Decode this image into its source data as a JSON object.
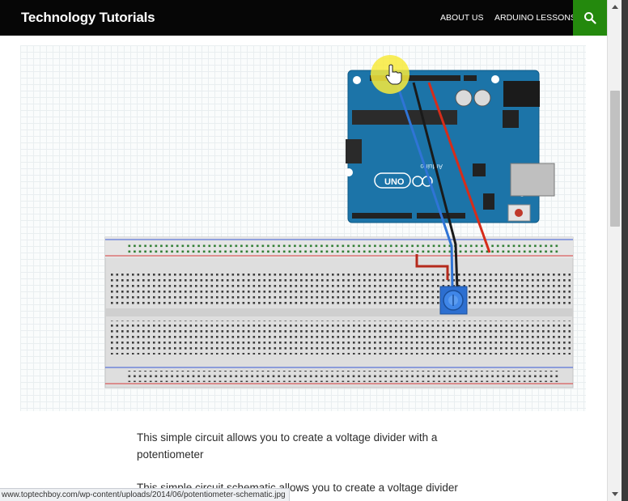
{
  "header": {
    "site_title": "Technology Tutorials",
    "nav": [
      {
        "label": "ABOUT US"
      },
      {
        "label": "ARDUINO LESSONS"
      }
    ],
    "search_icon": "search-icon",
    "accent_color": "#24890d"
  },
  "figure": {
    "board_label": "UNO",
    "board_brand": "Arduino",
    "components": [
      "arduino-uno-board",
      "breadboard",
      "potentiometer",
      "wire-red",
      "wire-black",
      "wire-blue"
    ],
    "wire_colors": {
      "red": "#d62c1a",
      "black": "#1a1a1a",
      "blue": "#2f74d6"
    }
  },
  "content": {
    "paragraph1": "This simple circuit allows you to create a voltage divider with a potentiometer",
    "paragraph2": "This simple circuit schematic allows you to create a voltage divider"
  },
  "status_bar": {
    "url": "www.toptechboy.com/wp-content/uploads/2014/06/potentiometer-schematic.jpg"
  }
}
